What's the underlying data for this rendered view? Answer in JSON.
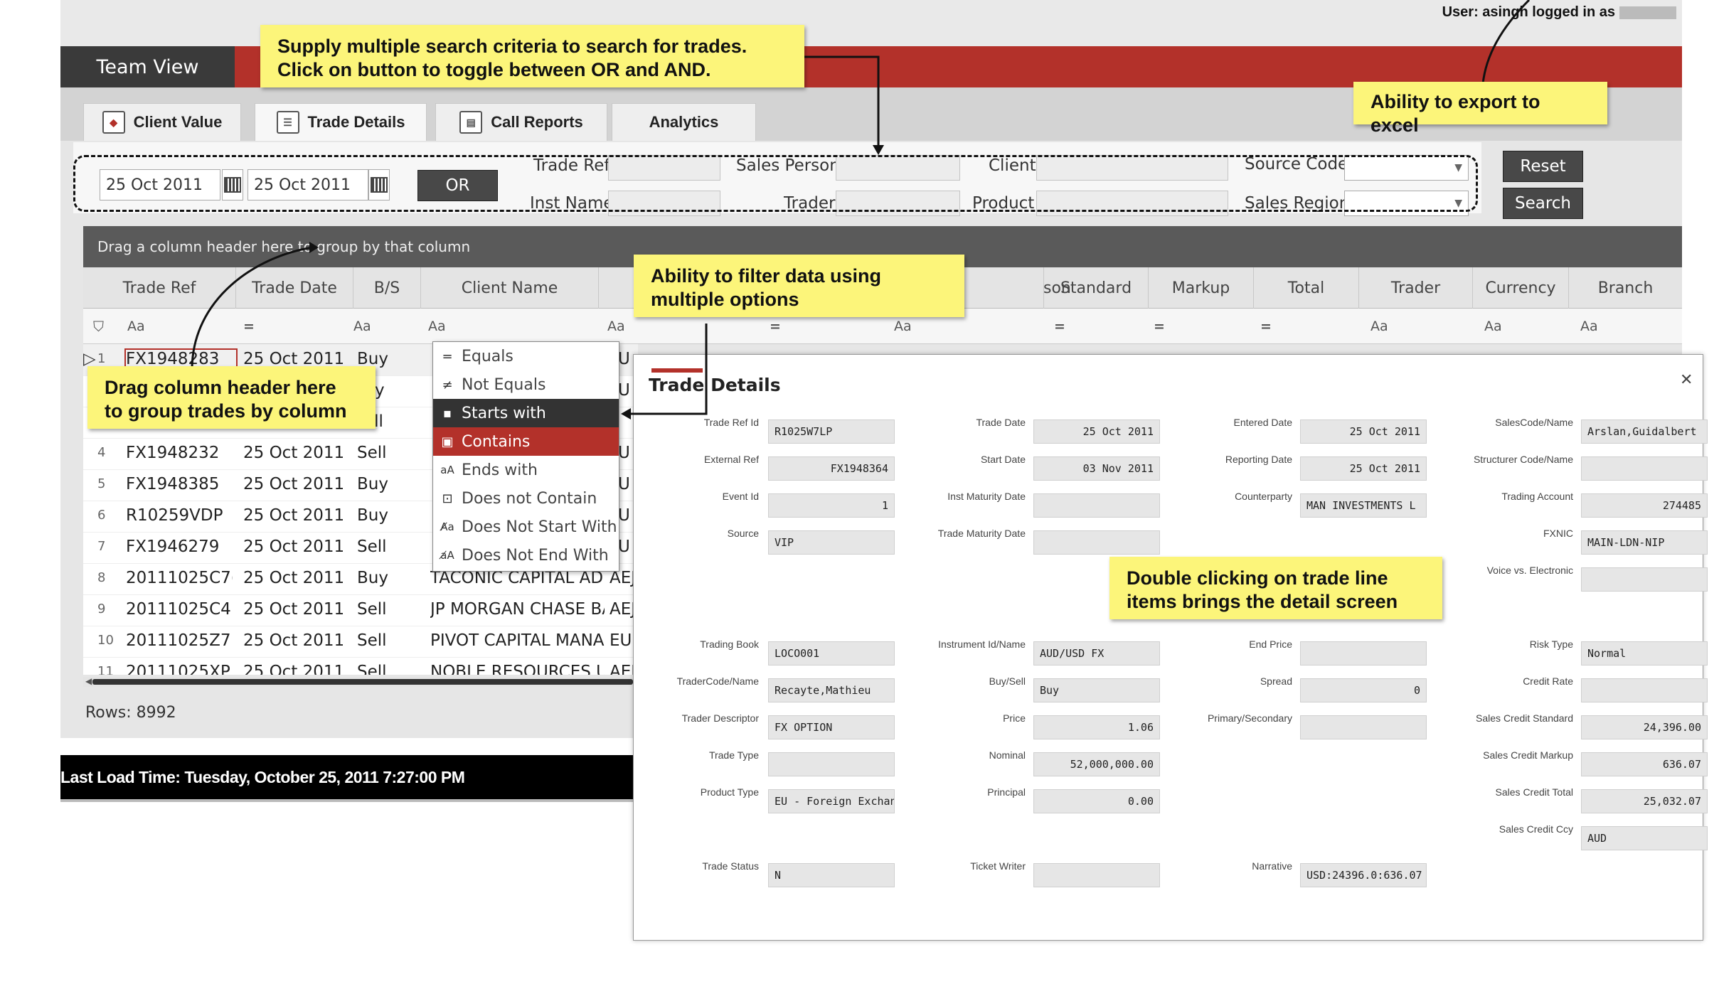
{
  "header": {
    "user_text": "User: asingh logged in as",
    "app_title": "Team View"
  },
  "tabs": [
    {
      "label": "Client Value",
      "icon": "client-value-icon"
    },
    {
      "label": "Trade Details",
      "icon": "trade-details-icon"
    },
    {
      "label": "Call Reports",
      "icon": "call-reports-icon"
    },
    {
      "label": "Analytics",
      "icon": ""
    }
  ],
  "search": {
    "date_from": "25 Oct 2011",
    "date_to": "25 Oct 2011",
    "toggle_label": "OR",
    "labels": {
      "trade_ref": "Trade Ref",
      "sales_person": "Sales Person",
      "client": "Client",
      "source_code": "Source Code",
      "inst_name": "Inst Name",
      "trader": "Trader",
      "product": "Product",
      "sales_region": "Sales Region"
    },
    "reset_label": "Reset",
    "search_label": "Search"
  },
  "grid": {
    "group_hint": "Drag a column header here to group by that column",
    "columns": [
      "Trade Ref",
      "Trade Date",
      "B/S",
      "Client Name",
      "",
      "",
      "",
      "son",
      "Standard",
      "Markup",
      "Total",
      "Trader",
      "Currency",
      "Branch"
    ],
    "filter_tokens": [
      "Aa",
      "=",
      "Aa",
      "Aa",
      "Aa",
      "=",
      "Aa",
      "=",
      "=",
      "=",
      "Aa",
      "Aa",
      "Aa"
    ],
    "rows": [
      {
        "n": "1",
        "ref": "FX1948283",
        "date": "25 Oct 2011",
        "bs": "Buy",
        "client": "",
        "x": "U"
      },
      {
        "n": "2",
        "ref": "",
        "date": "",
        "bs": "y",
        "client": "",
        "x": "U"
      },
      {
        "n": "3",
        "ref": "",
        "date": "",
        "bs": "ell",
        "client": "",
        "x": ""
      },
      {
        "n": "4",
        "ref": "FX1948232",
        "date": "25 Oct 2011",
        "bs": "Sell",
        "client": "",
        "x": "U"
      },
      {
        "n": "5",
        "ref": "FX1948385",
        "date": "25 Oct 2011",
        "bs": "Buy",
        "client": "",
        "x": "U"
      },
      {
        "n": "6",
        "ref": "R10259VDP",
        "date": "25 Oct 2011",
        "bs": "Buy",
        "client": "",
        "x": "U"
      },
      {
        "n": "7",
        "ref": "FX1946279",
        "date": "25 Oct 2011",
        "bs": "Sell",
        "client": "",
        "x": "U"
      },
      {
        "n": "8",
        "ref": "20111025C7(",
        "date": "25 Oct 2011",
        "bs": "Buy",
        "client": "TACONIC CAPITAL AD'",
        "x": "AEJ"
      },
      {
        "n": "9",
        "ref": "20111025C4!",
        "date": "25 Oct 2011",
        "bs": "Sell",
        "client": "JP MORGAN CHASE BA",
        "x": "AEJ"
      },
      {
        "n": "10",
        "ref": "20111025Z7:",
        "date": "25 Oct 2011",
        "bs": "Sell",
        "client": "PIVOT CAPITAL MANA(",
        "x": "EU"
      },
      {
        "n": "11",
        "ref": "20111025XP",
        "date": "25 Oct 2011",
        "bs": "Sell",
        "client": "NOBLE RESOURCES UI",
        "x": "AEJ"
      }
    ],
    "rows_count": "Rows: 8992"
  },
  "filter_menu": [
    {
      "label": "Equals",
      "icon": "equals-icon",
      "glyph": "="
    },
    {
      "label": "Not Equals",
      "icon": "not-equals-icon",
      "glyph": "≠"
    },
    {
      "label": "Starts with",
      "icon": "starts-with-icon",
      "glyph": "▪"
    },
    {
      "label": "Contains",
      "icon": "contains-icon",
      "glyph": "▣"
    },
    {
      "label": "Ends with",
      "icon": "ends-with-icon",
      "glyph": "aA"
    },
    {
      "label": "Does not Contain",
      "icon": "does-not-contain-icon",
      "glyph": "⊡"
    },
    {
      "label": "Does Not Start With",
      "icon": "does-not-start-with-icon",
      "glyph": "A̸a"
    },
    {
      "label": "Does Not End With",
      "icon": "does-not-end-with-icon",
      "glyph": "a̸A"
    }
  ],
  "footer": {
    "last_load": "Last Load Time: Tuesday, October 25, 2011 7:27:00 PM"
  },
  "detail": {
    "title_a": "Trade",
    "title_b": "Details",
    "fields": {
      "trade_ref_id": {
        "label": "Trade Ref Id",
        "value": "R1025W7LP"
      },
      "external_ref": {
        "label": "External Ref",
        "value": "FX1948364"
      },
      "event_id": {
        "label": "Event Id",
        "value": "1"
      },
      "source": {
        "label": "Source",
        "value": "VIP"
      },
      "trade_date": {
        "label": "Trade Date",
        "value": "25 Oct 2011"
      },
      "start_date": {
        "label": "Start Date",
        "value": "03 Nov 2011"
      },
      "inst_maturity": {
        "label": "Inst Maturity Date",
        "value": ""
      },
      "trade_maturity": {
        "label": "Trade Maturity Date",
        "value": ""
      },
      "entered_date": {
        "label": "Entered Date",
        "value": "25 Oct 2011"
      },
      "reporting_date": {
        "label": "Reporting Date",
        "value": "25 Oct 2011"
      },
      "counterparty": {
        "label": "Counterparty",
        "value": "MAN INVESTMENTS L"
      },
      "sales_code": {
        "label": "SalesCode/Name",
        "value": "Arslan,Guidalbert"
      },
      "structurer": {
        "label": "Structurer Code/Name",
        "value": ""
      },
      "trading_account": {
        "label": "Trading Account",
        "value": "274485"
      },
      "fxnic": {
        "label": "FXNIC",
        "value": "MAIN-LDN-NIP"
      },
      "voice_electronic": {
        "label": "Voice vs. Electronic",
        "value": ""
      },
      "trading_book": {
        "label": "Trading Book",
        "value": "LOCO001"
      },
      "trader_code": {
        "label": "TraderCode/Name",
        "value": "Recayte,Mathieu"
      },
      "trader_descriptor": {
        "label": "Trader Descriptor",
        "value": "FX OPTION"
      },
      "trade_type": {
        "label": "Trade Type",
        "value": ""
      },
      "product_type": {
        "label": "Product Type",
        "value": "EU - Foreign Exchang"
      },
      "trade_status": {
        "label": "Trade Status",
        "value": "N"
      },
      "instrument": {
        "label": "Instrument Id/Name",
        "value": "AUD/USD FX"
      },
      "buy_sell": {
        "label": "Buy/Sell",
        "value": "Buy"
      },
      "price": {
        "label": "Price",
        "value": "1.06"
      },
      "nominal": {
        "label": "Nominal",
        "value": "52,000,000.00"
      },
      "principal": {
        "label": "Principal",
        "value": "0.00"
      },
      "ticket_writer": {
        "label": "Ticket Writer",
        "value": ""
      },
      "end_price": {
        "label": "End Price",
        "value": ""
      },
      "spread": {
        "label": "Spread",
        "value": "0"
      },
      "primary_secondary": {
        "label": "Primary/Secondary",
        "value": ""
      },
      "narrative": {
        "label": "Narrative",
        "value": "USD:24396.0:636.07"
      },
      "risk_type": {
        "label": "Risk Type",
        "value": "Normal"
      },
      "credit_rate": {
        "label": "Credit Rate",
        "value": ""
      },
      "sc_standard": {
        "label": "Sales Credit Standard",
        "value": "24,396.00"
      },
      "sc_markup": {
        "label": "Sales Credit Markup",
        "value": "636.07"
      },
      "sc_total": {
        "label": "Sales Credit Total",
        "value": "25,032.07"
      },
      "sc_ccy": {
        "label": "Sales Credit Ccy",
        "value": "AUD"
      }
    }
  },
  "callouts": {
    "search_criteria": [
      "Supply multiple search criteria to search for trades.",
      "Click on button to toggle between OR  and AND."
    ],
    "export_excel": "Ability to export to excel",
    "filter_options": [
      "Ability to filter data using",
      "multiple options"
    ],
    "drag_header": [
      "Drag column header  here",
      "to group trades by column"
    ],
    "double_click": [
      "Double clicking on trade line",
      "items brings the detail screen"
    ]
  }
}
